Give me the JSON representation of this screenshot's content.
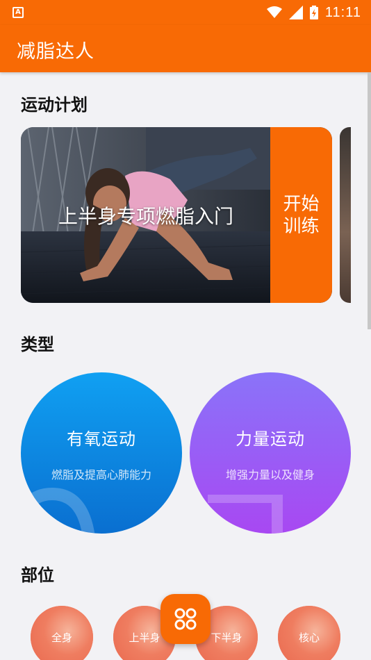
{
  "status_bar": {
    "time": "11:11",
    "app_icon_letter": "A"
  },
  "app_bar": {
    "title": "减脂达人",
    "color": "#f86a05"
  },
  "sections": {
    "plan": "运动计划",
    "type": "类型",
    "part": "部位"
  },
  "plan_card": {
    "title": "上半身专项燃脂入门",
    "start_label": "开始训练"
  },
  "types": [
    {
      "name": "有氧运动",
      "desc": "燃脂及提高心肺能力",
      "colors": [
        "#10a0f2",
        "#0a6fd0"
      ]
    },
    {
      "name": "力量运动",
      "desc": "增强力量以及健身",
      "colors": [
        "#8a73f9",
        "#a848f2"
      ]
    }
  ],
  "parts": [
    {
      "label": "全身"
    },
    {
      "label": "上半身"
    },
    {
      "label": "下半身"
    },
    {
      "label": "核心"
    }
  ],
  "fab": {
    "icon": "grid-icon"
  }
}
